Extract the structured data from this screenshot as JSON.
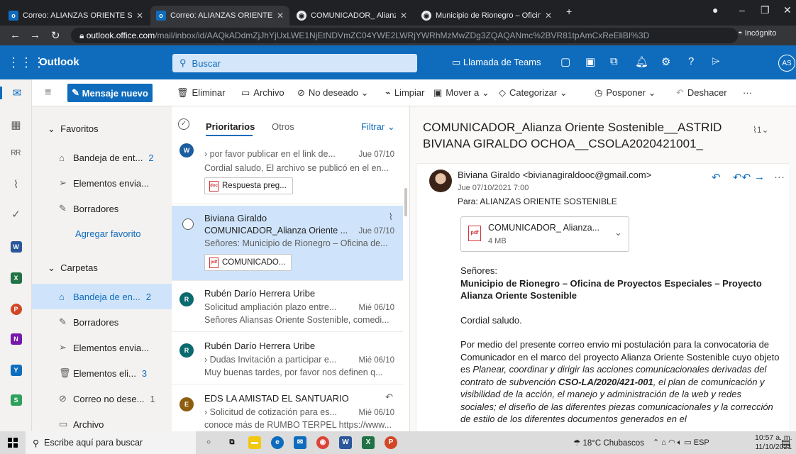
{
  "browser": {
    "tabs": [
      {
        "title": "Correo: ALIANZAS ORIENTE SOS"
      },
      {
        "title": "Correo: ALIANZAS ORIENTE SOS"
      },
      {
        "title": "COMUNICADOR_ Alianza Oriente"
      },
      {
        "title": "Municipio de Rionegro – Oficina"
      }
    ],
    "url_host": "outlook.office.com",
    "url_path": "/mail/inbox/id/AAQkADdmZjJhYjUxLWE1NjEtNDVmZC04YWE2LWRjYWRhMzMwZDg3ZQAQANmc%2BVR81tpAmCxReEliBI%3D",
    "incognito_label": "Incógnito"
  },
  "suite": {
    "brand": "Outlook",
    "search_placeholder": "Buscar",
    "teams_label": "Llamada de Teams",
    "avatar_initials": "AS"
  },
  "toolbar": {
    "new_message": "Mensaje nuevo",
    "delete": "Eliminar",
    "archive": "Archivo",
    "junk": "No deseado",
    "sweep": "Limpiar",
    "move": "Mover a",
    "categorize": "Categorizar",
    "snooze": "Posponer",
    "undo": "Deshacer"
  },
  "folders": {
    "favorites_header": "Favoritos",
    "favorites": [
      {
        "label": "Bandeja de ent...",
        "count": "2"
      },
      {
        "label": "Elementos envia...",
        "count": ""
      },
      {
        "label": "Borradores",
        "count": ""
      }
    ],
    "add_favorite": "Agregar favorito",
    "folders_header": "Carpetas",
    "items": [
      {
        "label": "Bandeja de en...",
        "count": "2"
      },
      {
        "label": "Borradores",
        "count": ""
      },
      {
        "label": "Elementos envia...",
        "count": ""
      },
      {
        "label": "Elementos eli...",
        "count": "3"
      },
      {
        "label": "Correo no dese...",
        "count": "1"
      },
      {
        "label": "Archivo",
        "count": ""
      }
    ]
  },
  "list": {
    "tab_focused": "Prioritarios",
    "tab_other": "Otros",
    "filter": "Filtrar",
    "messages": [
      {
        "initial": "W",
        "color": "#1b5e9f",
        "sender": "",
        "subject": "por favor publicar en el link de...",
        "date": "Jue 07/10",
        "preview": "Cordial saludo, El archivo se publicó en el en...",
        "attachment": "Respuesta preg..."
      },
      {
        "initial": "",
        "color": "#0f6cbd",
        "sender": "Biviana Giraldo",
        "subject": "COMUNICADOR_Alianza Oriente ...",
        "date": "Jue 07/10",
        "preview": "Señores: Municipio de Rionegro – Oficina de...",
        "attachment": "COMUNICADO..."
      },
      {
        "initial": "R",
        "color": "#0b6a6d",
        "sender": "Rubén Darío Herrera Uribe",
        "subject": "Solicitud ampliación plazo entre...",
        "date": "Mié 06/10",
        "preview": "Señores Aliansas Oriente Sostenible, comedi...",
        "attachment": ""
      },
      {
        "initial": "R",
        "color": "#0b6a6d",
        "sender": "Rubén Darío Herrera Uribe",
        "subject": "Dudas Invitación a participar e...",
        "date": "Mié 06/10",
        "preview": "Muy buenas tardes, por favor nos definen q...",
        "attachment": ""
      },
      {
        "initial": "E",
        "color": "#8e5e0f",
        "sender": "EDS LA AMISTAD EL SANTUARIO",
        "subject": "Solicitud de cotización para es...",
        "date": "Mié 06/10",
        "preview": "conoce más de RUMBO TERPEL https://www...",
        "attachment": ""
      }
    ]
  },
  "reading": {
    "subject": "COMUNICADOR_Alianza Oriente Sostenible__ASTRID BIVIANA GIRALDO OCHOA__CSOLA2020421001_",
    "attachment_count": "1",
    "from": "Biviana Giraldo <bivianagiraldooc@gmail.com>",
    "date": "Jue 07/10/2021 7:00",
    "to": "Para:  ALIANZAS ORIENTE SOSTENIBLE",
    "attachment_name": "COMUNICADOR_ Alianza...",
    "attachment_size": "4 MB",
    "greeting": "Señores:",
    "addressee": "Municipio de Rionegro – Oficina de Proyectos Especiales – Proyecto Alianza Oriente Sostenible",
    "salutation": "Cordial saludo.",
    "para_intro": "Por medio del presente correo envio mi postulación para la convocatoria de Comunicador en el marco del proyecto Alianza Oriente Sostenible cuyo objeto es ",
    "para_obj1": "Planear, coordinar y dirigir las acciones comunicacionales derivadas del contrato de subvención ",
    "para_code": "CSO-LA/2020/421-001",
    "para_obj2": ", el plan de comunicación y visibilidad de la acción, el manejo y administración de la web y redes sociales; el diseño de las diferentes piezas comunicacionales y la corrección de estilo de los diferentes documentos generados en el"
  },
  "taskbar": {
    "search_placeholder": "Escribe aquí para buscar",
    "weather": "18°C  Chubascos",
    "lang": "ESP",
    "time": "10:57 a. m.",
    "date": "11/10/2021"
  }
}
